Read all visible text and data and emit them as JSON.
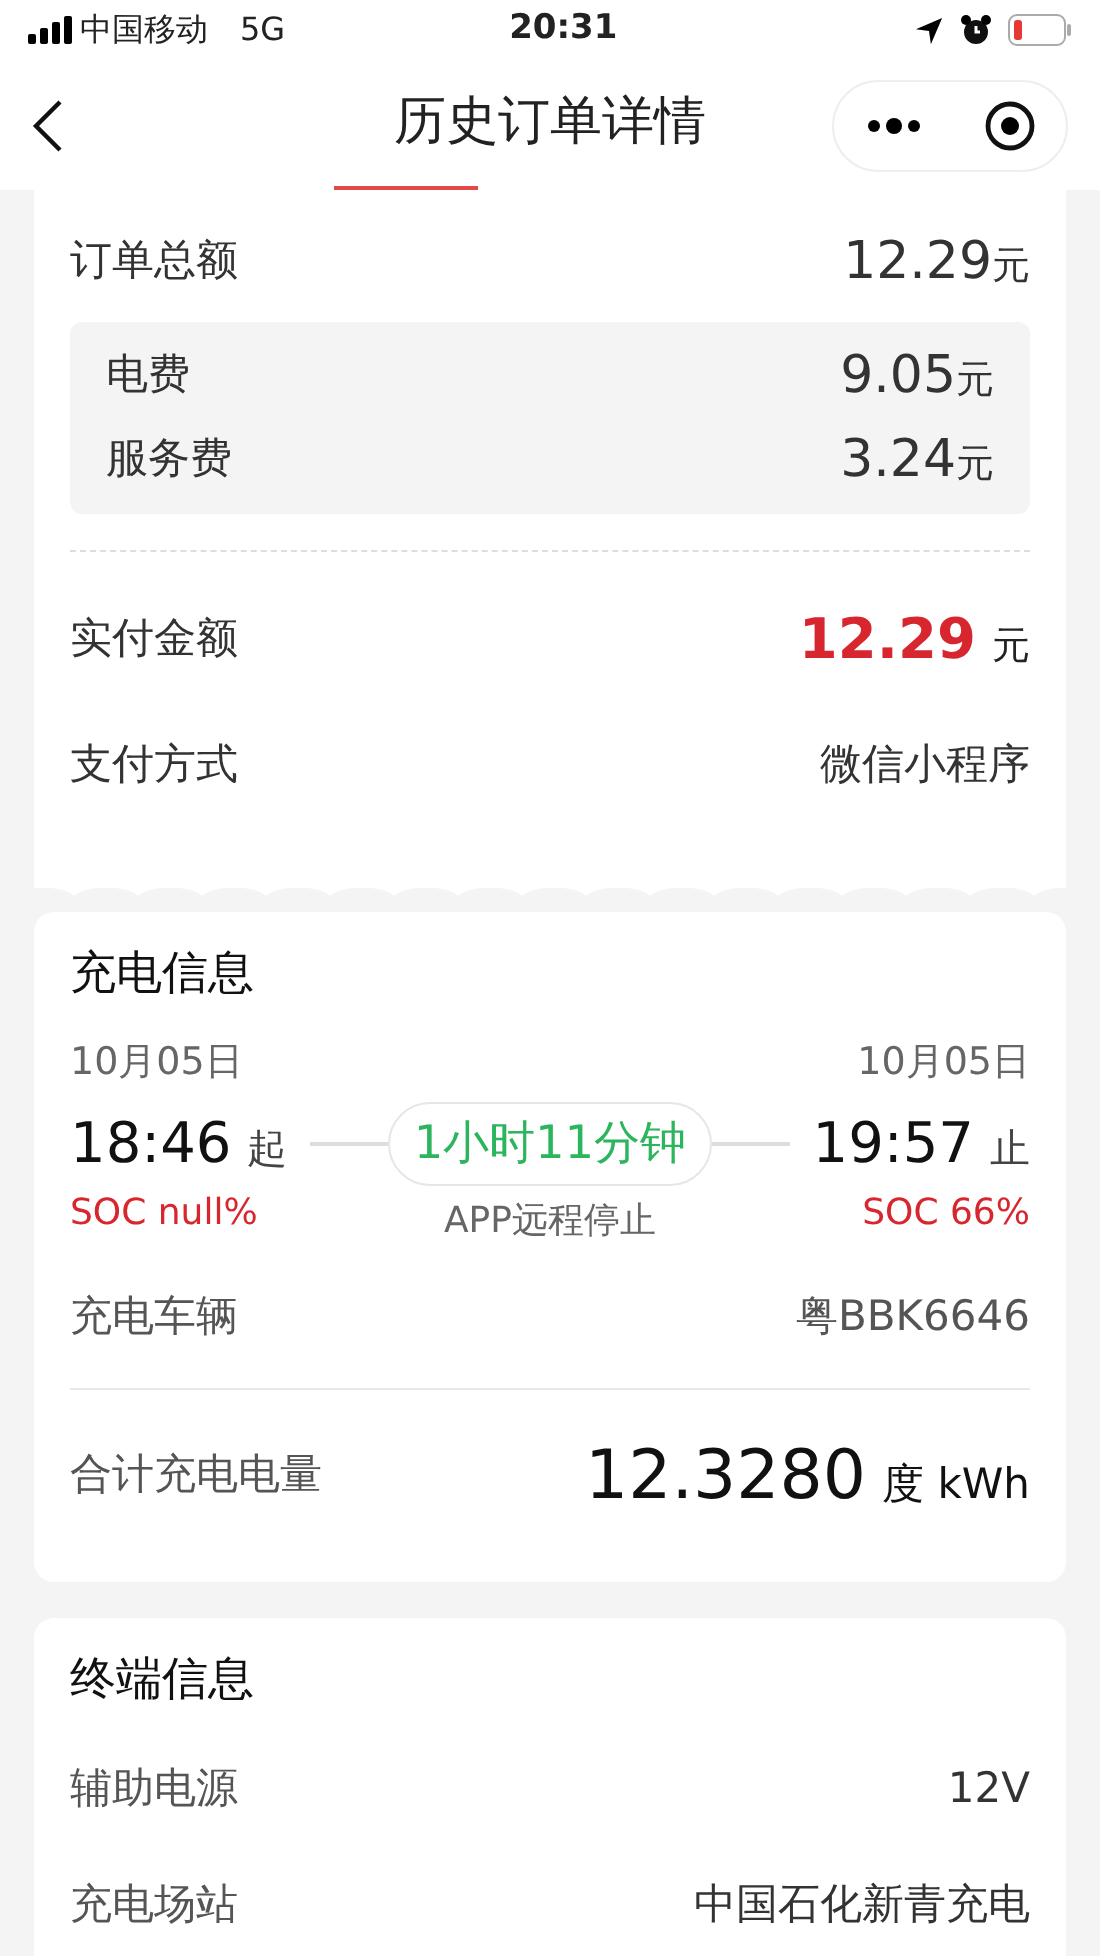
{
  "status_bar": {
    "carrier": "中国移动",
    "network": "5G",
    "time": "20:31"
  },
  "header": {
    "title": "历史订单详情"
  },
  "order": {
    "total": {
      "label": "订单总额",
      "amount": "12.29",
      "unit": "元"
    },
    "breakdown": [
      {
        "label": "电费",
        "amount": "9.05",
        "unit": "元"
      },
      {
        "label": "服务费",
        "amount": "3.24",
        "unit": "元"
      }
    ],
    "paid": {
      "label": "实付金额",
      "amount": "12.29",
      "unit": "元"
    },
    "payment": {
      "label": "支付方式",
      "value": "微信小程序"
    }
  },
  "charging": {
    "title": "充电信息",
    "start": {
      "date": "10月05日",
      "time": "18:46",
      "suffix": "起",
      "soc": "SOC null%"
    },
    "end": {
      "date": "10月05日",
      "time": "19:57",
      "suffix": "止",
      "soc": "SOC 66%"
    },
    "duration": "1小时11分钟",
    "stop_reason": "APP远程停止",
    "vehicle": {
      "label": "充电车辆",
      "value": "粤BBK6646"
    },
    "energy": {
      "label": "合计充电电量",
      "amount": "12.3280",
      "unit": "度 kWh"
    }
  },
  "terminal": {
    "title": "终端信息",
    "rows": [
      {
        "label": "辅助电源",
        "value": "12V"
      },
      {
        "label": "充电场站",
        "value": "中国石化新青充电"
      }
    ]
  }
}
